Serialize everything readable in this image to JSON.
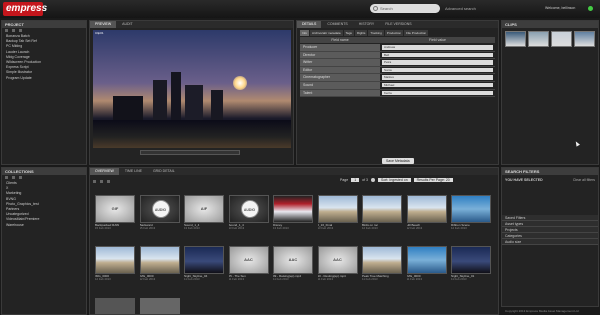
{
  "app": {
    "logo": "empress",
    "search_placeholder": "Search",
    "advanced_search": "Advanced search",
    "welcome": "Welcome, bellinson"
  },
  "project": {
    "title": "PROJECT",
    "items": [
      "Bonanza Batch",
      "Backup Tab Set Ref",
      "PC Mkting",
      "Lauder Launch",
      "Mktg Coverage",
      "Wildscreen Production",
      "Express Script",
      "Simple Illustrator",
      "Program Update"
    ]
  },
  "collections": {
    "title": "COLLECTIONS",
    "items": [
      "Clients",
      "X",
      "Marketing",
      "BVNG",
      "Photo_Graphics_test",
      "Partners",
      "Uncategorized",
      "VideosMain/Premiere",
      "Warehouse"
    ]
  },
  "preview": {
    "tabs": [
      "PREVIEW",
      "AUDIT"
    ],
    "filename": "Clip01"
  },
  "details": {
    "tabs": [
      "DETAILS",
      "COMMENTS",
      "HISTORY",
      "FILE VERSIONS"
    ],
    "subtabs": [
      "Info",
      "Archive/attr metadata",
      "Tags",
      "Rights",
      "Tracking",
      "Production",
      "File Production"
    ],
    "col_field": "Field name",
    "col_value": "Field value",
    "rows": [
      {
        "l": "Producer",
        "v": "Andreas"
      },
      {
        "l": "Director",
        "v": "Bell"
      },
      {
        "l": "Writer",
        "v": "Petra"
      },
      {
        "l": "Editor",
        "v": "Sonia"
      },
      {
        "l": "Cinematographer",
        "v": "Markus"
      },
      {
        "l": "Sound",
        "v": "Michael"
      },
      {
        "l": "Talent",
        "v": "Kerrie"
      }
    ],
    "save": "Save Metadata"
  },
  "clips": {
    "title": "CLIPS",
    "items": [
      {
        "cap": "",
        "sub": "1",
        "c": "#3a5a7a"
      },
      {
        "cap": "",
        "sub": "2",
        "c": "#8aa0b0"
      },
      {
        "cap": "",
        "sub": "3",
        "c": "#c8d0d8"
      },
      {
        "cap": "",
        "sub": "4",
        "c": "#6080a0"
      }
    ]
  },
  "grid": {
    "tabs": [
      "OVERVIEW",
      "TIME LINE",
      "GRID DETAIL"
    ],
    "page_label": "Page",
    "page": "1",
    "of": "of 3",
    "sort": "Sort: Ingested on",
    "view": "Results Per Page: 20",
    "row1": [
      {
        "type": "gray",
        "label": "GIF",
        "cap": "Backpacked RAW",
        "sub": "15 Feb 2013"
      },
      {
        "type": "circ",
        "label": "AUDIO",
        "cap": "Backward",
        "sub": "15 Feb 2013"
      },
      {
        "type": "gray",
        "label": "AIF",
        "cap": "Sound_1_4",
        "sub": "13 Feb 2013"
      },
      {
        "type": "circ",
        "label": "AUDIO",
        "cap": "Sound_1_4",
        "sub": "13 Feb 2013"
      },
      {
        "type": "red",
        "label": "",
        "cap": "Disney",
        "sub": "13 Feb 2013"
      },
      {
        "type": "sky",
        "label": "",
        "cap": "Il_16_Final",
        "sub": "13 Feb 2013"
      },
      {
        "type": "sky",
        "label": "",
        "cap": "Birds on roc",
        "sub": "12 Feb 2013"
      },
      {
        "type": "sky",
        "label": "",
        "cap": "Hill Beach",
        "sub": "12 Feb 2013"
      },
      {
        "type": "ocean",
        "label": "",
        "cap": "Ribbon Scene",
        "sub": "12 Feb 2013"
      }
    ],
    "row2": [
      {
        "type": "sky",
        "label": "",
        "cap": "IMG_0000",
        "sub": "12 Feb 2013"
      },
      {
        "type": "sky",
        "label": "",
        "cap": "IMG_0000",
        "sub": "12 Feb 2013"
      },
      {
        "type": "city",
        "label": "",
        "cap": "Night_Skyline_04",
        "sub": "11 Feb 2013"
      },
      {
        "type": "gray",
        "label": "AAC",
        "cap": "05 - The Sun",
        "sub": "11 Feb 2013"
      },
      {
        "type": "gray",
        "label": "AAC",
        "cap": "09 - Raising(ep).mp4",
        "sub": "11 Feb 2013"
      },
      {
        "type": "gray",
        "label": "AAC",
        "cap": "10 - Resting(ep).mp4",
        "sub": "11 Feb 2013"
      },
      {
        "type": "sky",
        "label": "",
        "cap": "Peak Tree Matching",
        "sub": "11 Feb 2013"
      },
      {
        "type": "ocean",
        "label": "",
        "cap": "IMG_0000",
        "sub": "11 Feb 2013"
      },
      {
        "type": "city",
        "label": "",
        "cap": "Night_Skyline_01",
        "sub": "11 Feb 2013"
      }
    ]
  },
  "search_filters": {
    "title": "SEARCH FILTERS",
    "none": "YOU HAVE SELECTED",
    "clear": "Clear all filters",
    "sections": [
      "Saved Filters",
      "Asset types",
      "Projects",
      "Categories",
      "Audio size"
    ]
  },
  "footer": "Copyright 2013 Empress Media Asset Management Ltd"
}
